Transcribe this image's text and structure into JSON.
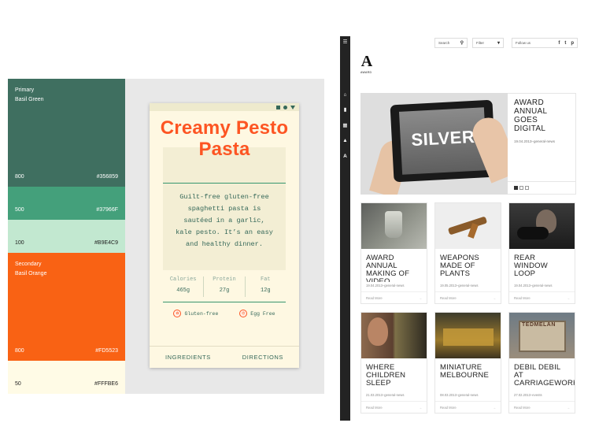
{
  "palette": {
    "primary": {
      "label_1": "Primary",
      "label_2": "Basil Green"
    },
    "secondary": {
      "label_1": "Secondary",
      "label_2": "Basil Orange"
    },
    "swatches": [
      {
        "shade": "800",
        "hex": "#356859"
      },
      {
        "shade": "500",
        "hex": "#37966F"
      },
      {
        "shade": "100",
        "hex": "#B9E4C9"
      },
      {
        "shade": "800",
        "hex": "#FD5523"
      },
      {
        "shade": "50",
        "hex": "#FFFBE6"
      }
    ]
  },
  "recipe": {
    "title": "Creamy Pesto Pasta",
    "description": "Guilt-free gluten-free spaghetti pasta is sautéed in a garlic, kale pesto. It’s an easy and healthy dinner.",
    "stats": [
      {
        "label": "Calories",
        "value": "465g"
      },
      {
        "label": "Protein",
        "value": "27g"
      },
      {
        "label": "Fat",
        "value": "12g"
      }
    ],
    "tags": [
      {
        "label": "Gluten-free",
        "icon": "wheat-icon"
      },
      {
        "label": "Egg Free",
        "icon": "egg-icon"
      }
    ],
    "tabs": [
      "INGREDIENTS",
      "DIRECTIONS"
    ]
  },
  "site": {
    "search_label": "Search",
    "filter_label": "Filter",
    "follow_label": "Follow us",
    "logo_letter": "A",
    "logo_word": "AWARD",
    "rail_icons": [
      "menu-icon",
      "home-icon",
      "bookmark-icon",
      "calendar-icon",
      "graduation-icon",
      "award-icon"
    ],
    "feature": {
      "image_text": "SILVER",
      "title": "AWARD ANNUAL GOES DIGITAL",
      "meta": "19.04.2013–general-news"
    },
    "read_more": "Read More",
    "cards": [
      {
        "title": "AWARD ANNUAL MAKING OF VIDEO",
        "meta": "19.04.2013–general-news"
      },
      {
        "title": "WEAPONS MADE OF PLANTS",
        "meta": "19.05.2013–general-news"
      },
      {
        "title": "REAR WINDOW LOOP",
        "meta": "19.04.2013–general-news"
      },
      {
        "title": "WHERE CHILDREN SLEEP",
        "meta": "21.03.2013–general-news"
      },
      {
        "title": "MINIATURE MELBOURNE",
        "meta": "08.03.2013–general-news"
      },
      {
        "title": "DEBIL DEBIL AT CARRIAGEWORKS",
        "meta": "27.02.2013–events"
      }
    ],
    "card6_image_text": "TEDMELAN"
  },
  "colors": {
    "basil_green_800": "#356859",
    "basil_green_500": "#37966F",
    "basil_green_100": "#B9E4C9",
    "basil_orange_800": "#FD5523",
    "basil_cream_50": "#FFFBE6"
  }
}
